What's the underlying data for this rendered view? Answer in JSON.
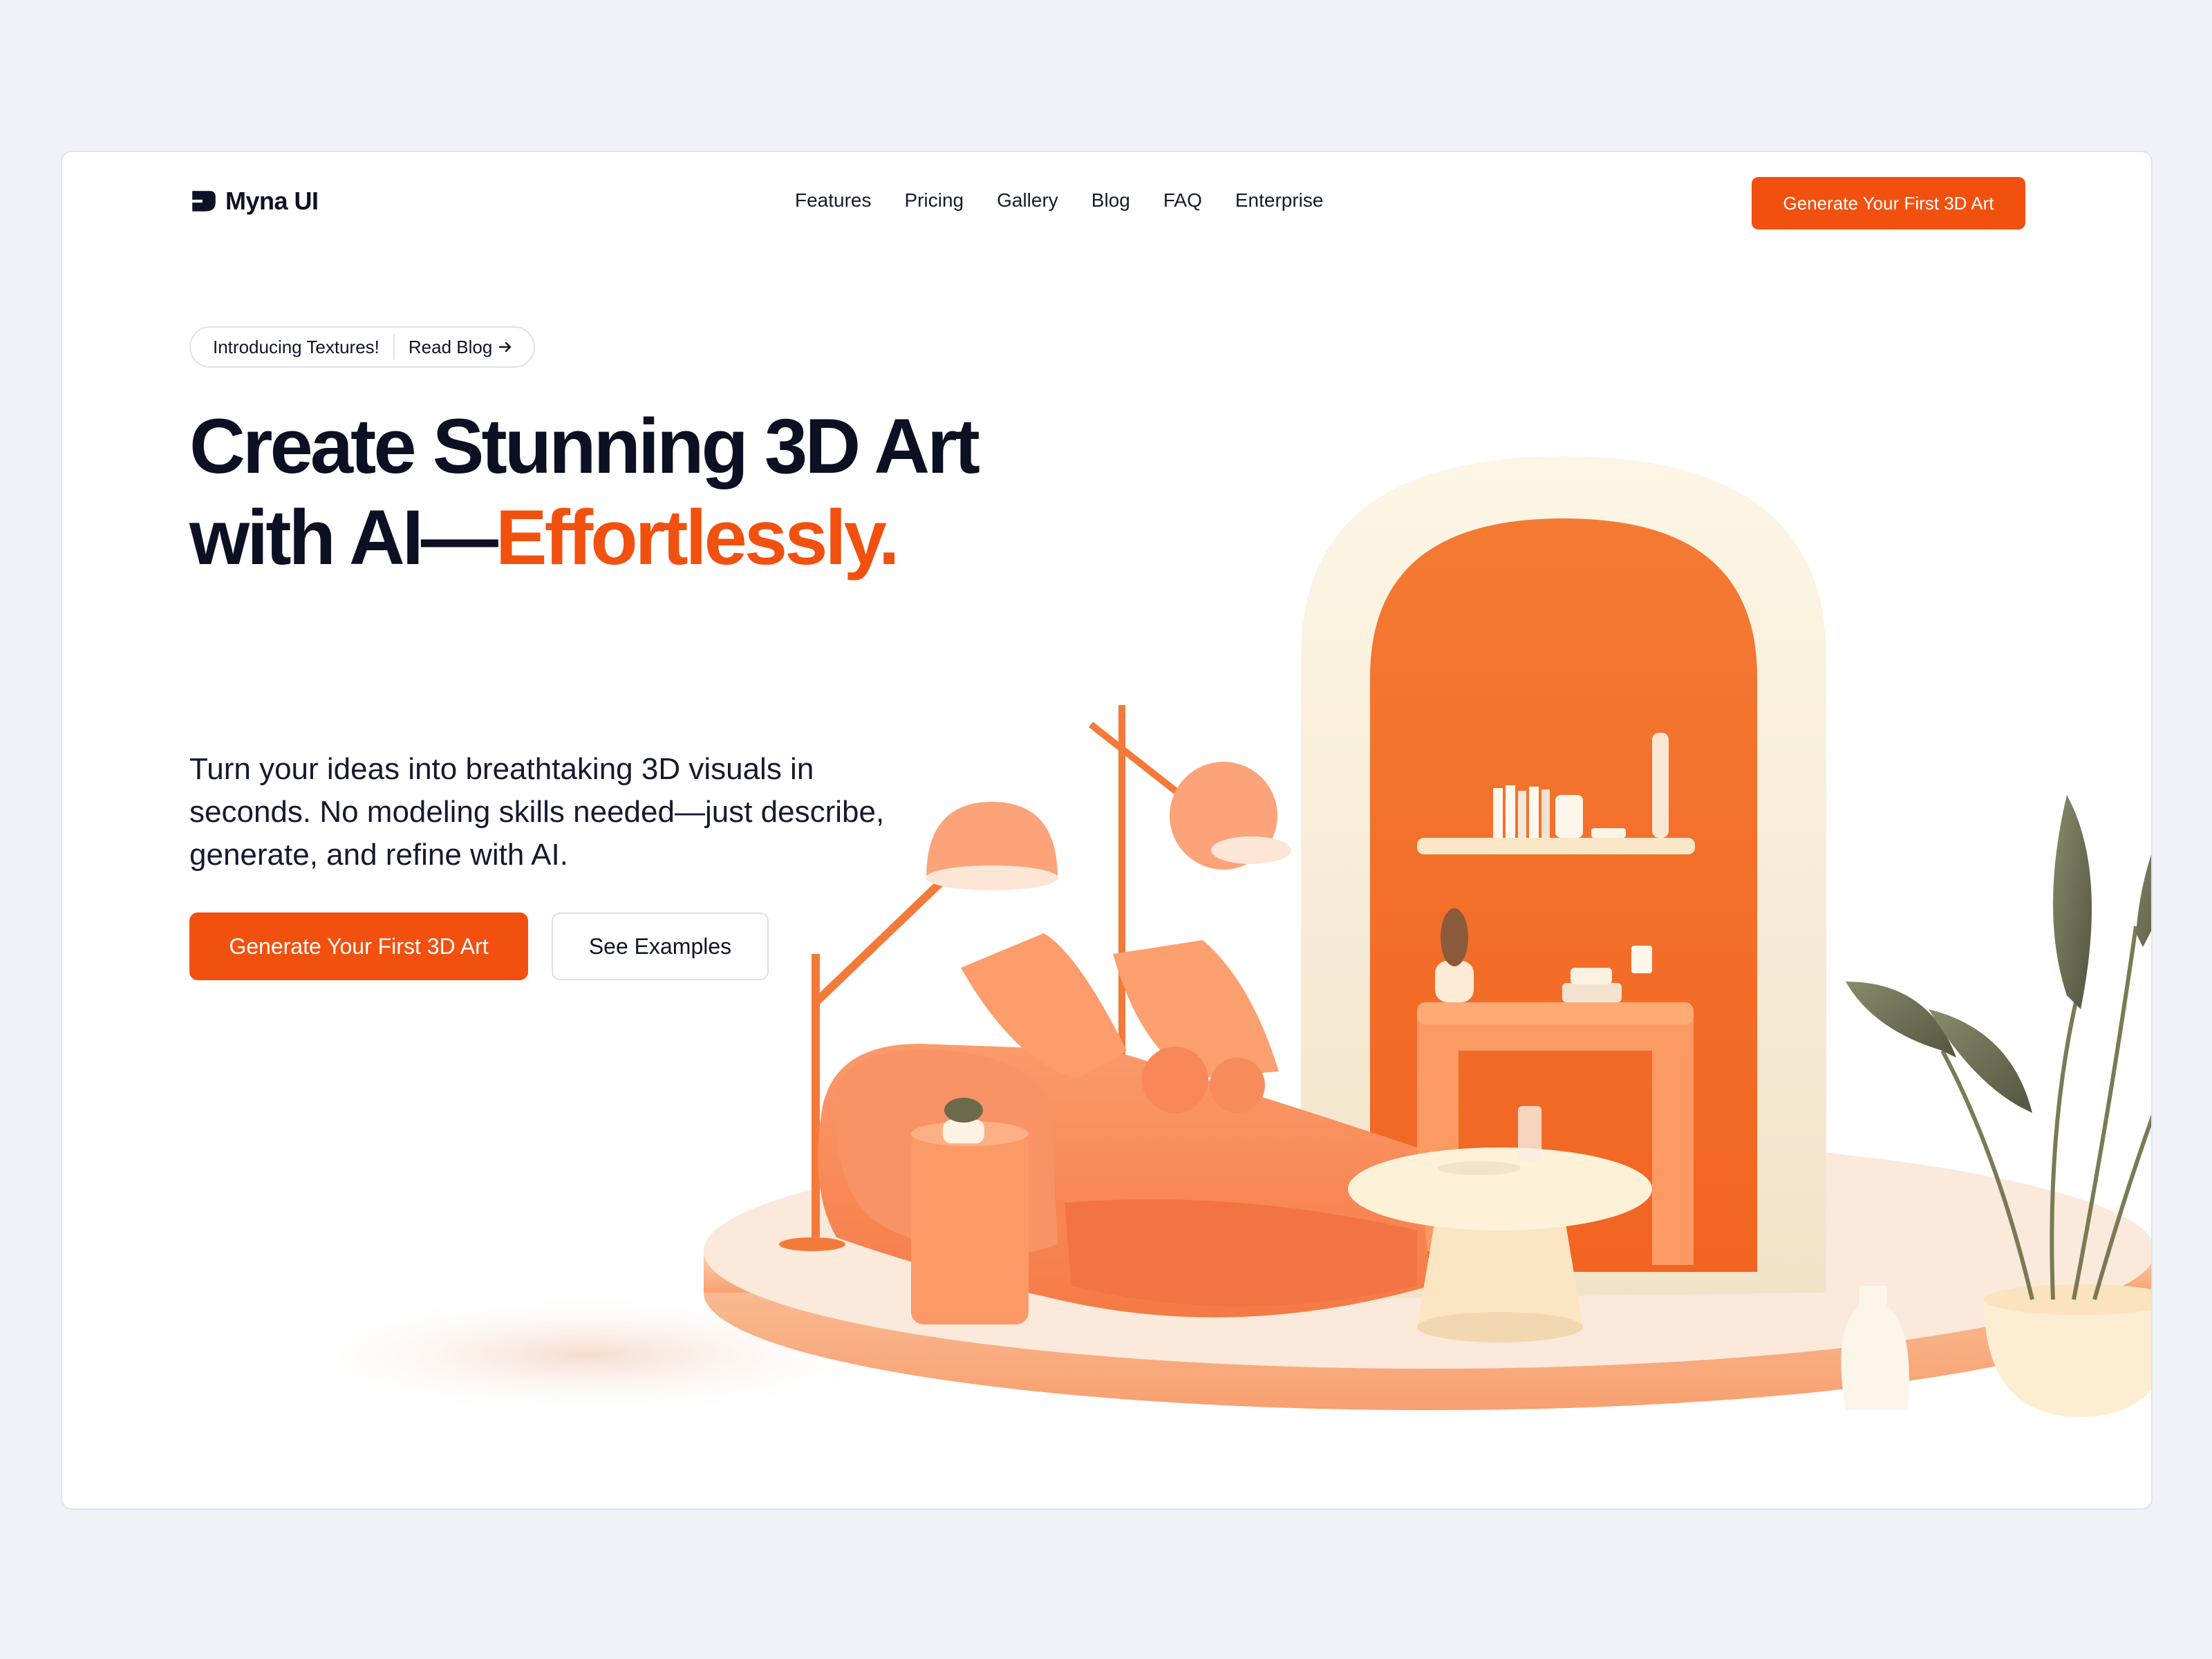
{
  "brand": {
    "name": "Myna UI",
    "logo_icon": "myna-logo-mark"
  },
  "nav": {
    "links": [
      "Features",
      "Pricing",
      "Gallery",
      "Blog",
      "FAQ",
      "Enterprise"
    ],
    "cta_label": "Generate Your First 3D Art"
  },
  "announcement": {
    "label": "Introducing Textures!",
    "link_label": "Read Blog",
    "link_icon": "arrow-right-icon"
  },
  "hero": {
    "headline_line1": "Create Stunning 3D Art",
    "headline_line2_prefix": "with AI—",
    "headline_accent": "Effortlessly.",
    "subtitle": "Turn your ideas into breathtaking 3D visuals in seconds. No modeling skills needed—just describe, generate, and refine with AI.",
    "primary_cta": "Generate Your First 3D Art",
    "secondary_cta": "See Examples"
  },
  "illustration": {
    "subject": "3d-living-room-scene"
  },
  "colors": {
    "accent": "#f2500f",
    "background": "#eff3f8",
    "text": "#0b1023",
    "card": "#ffffff"
  }
}
